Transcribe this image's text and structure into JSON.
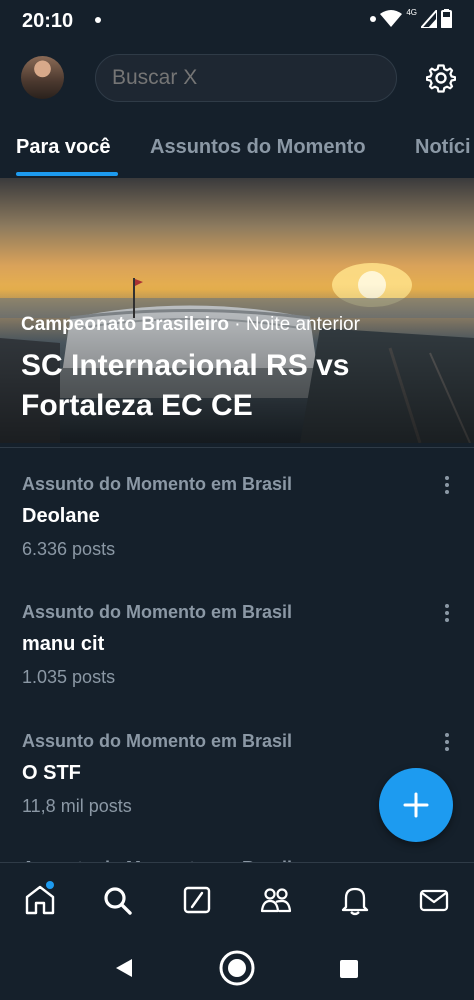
{
  "status_bar": {
    "time": "20:10",
    "network": "4G"
  },
  "header": {
    "search_placeholder": "Buscar X"
  },
  "tabs": [
    {
      "label": "Para você",
      "active": true
    },
    {
      "label": "Assuntos do Momento",
      "active": false
    },
    {
      "label": "Notíci",
      "active": false
    }
  ],
  "hero": {
    "category": "Campeonato Brasileiro",
    "separator": " · ",
    "time": "Noite anterior",
    "title": "SC Internacional RS vs Fortaleza EC CE"
  },
  "trends": [
    {
      "context": "Assunto do Momento em Brasil",
      "name": "Deolane",
      "count": "6.336 posts"
    },
    {
      "context": "Assunto do Momento em Brasil",
      "name": "manu cit",
      "count": "1.035 posts"
    },
    {
      "context": "Assunto do Momento em Brasil",
      "name": "O STF",
      "count": "11,8 mil posts"
    },
    {
      "context": "Assunto do Momento em Brasil",
      "name": "",
      "count": ""
    }
  ],
  "bottom_nav": [
    {
      "icon": "home-icon",
      "notification": true
    },
    {
      "icon": "search-icon",
      "notification": false
    },
    {
      "icon": "grok-icon",
      "notification": false
    },
    {
      "icon": "communities-icon",
      "notification": false
    },
    {
      "icon": "bell-icon",
      "notification": false
    },
    {
      "icon": "mail-icon",
      "notification": false
    }
  ],
  "colors": {
    "background": "#15202b",
    "accent": "#1d9bf0",
    "muted_text": "#8b98a5"
  }
}
